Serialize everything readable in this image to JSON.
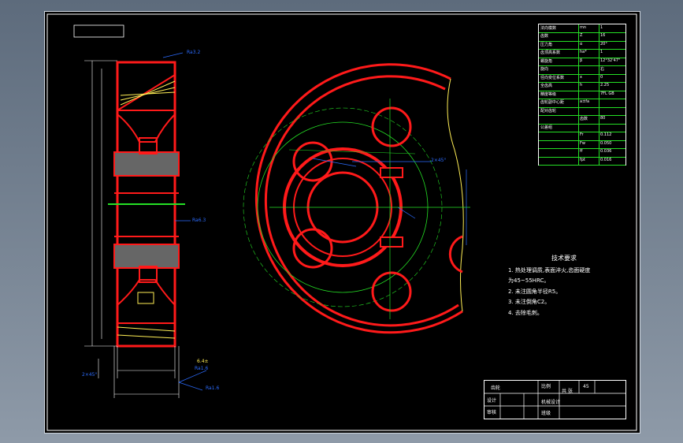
{
  "technical_requirements": {
    "title": "技术要求",
    "items": [
      "1.   热处理调质,表面淬火,齿面硬度",
      "     为45~55HRC。",
      "2.   未注圆角半径R5。",
      "3.   未注倒角C2。",
      "4.   去除毛刺。"
    ]
  },
  "parameter_table": {
    "rows": [
      {
        "c1": "法向模数",
        "c2": "mn",
        "c3": "1"
      },
      {
        "c1": "齿数",
        "c2": "Z",
        "c3": "16"
      },
      {
        "c1": "压力角",
        "c2": "α",
        "c3": "20°"
      },
      {
        "c1": "齿顶高系数",
        "c2": "ha*",
        "c3": "1"
      },
      {
        "c1": "螺旋角",
        "c2": "β",
        "c3": "12°32'47\""
      },
      {
        "c1": "旋向",
        "c2": "",
        "c3": "右"
      },
      {
        "c1": "径向变位系数",
        "c2": "x",
        "c3": "0"
      },
      {
        "c1": "全齿高",
        "c2": "h",
        "c3": "2.25"
      },
      {
        "c1": "精度等级",
        "c2": "",
        "c3": "7FL GB"
      },
      {
        "c1": "齿轮副中心距",
        "c2": "a±fa",
        "c3": ""
      },
      {
        "c1": "配对齿轮",
        "c2": "",
        "c3": ""
      },
      {
        "c1": "",
        "c2": "齿数",
        "c3": "80"
      },
      {
        "c1": "公差组",
        "c2": "",
        "c3": ""
      },
      {
        "c1": "",
        "c2": "Fr",
        "c3": "0.112"
      },
      {
        "c1": "",
        "c2": "Fw",
        "c3": "0.050"
      },
      {
        "c1": "",
        "c2": "ff",
        "c3": "0.036"
      },
      {
        "c1": "",
        "c2": "fpt",
        "c3": "0.016"
      }
    ]
  },
  "title_block": {
    "name": "齿轮",
    "material": "45",
    "scale_label": "比例",
    "sheet_label": "共 张",
    "designer": "设计",
    "checker": "审核",
    "school": "机械设计",
    "class_label": "班级"
  },
  "dimension_labels": {
    "d1": "2×45°",
    "d2": "Ra3.2",
    "d3": "Ra6.3",
    "d4": "Ra1.6",
    "d5": "6.4±",
    "d6": "2×45°",
    "d7": "Ra1.6"
  }
}
